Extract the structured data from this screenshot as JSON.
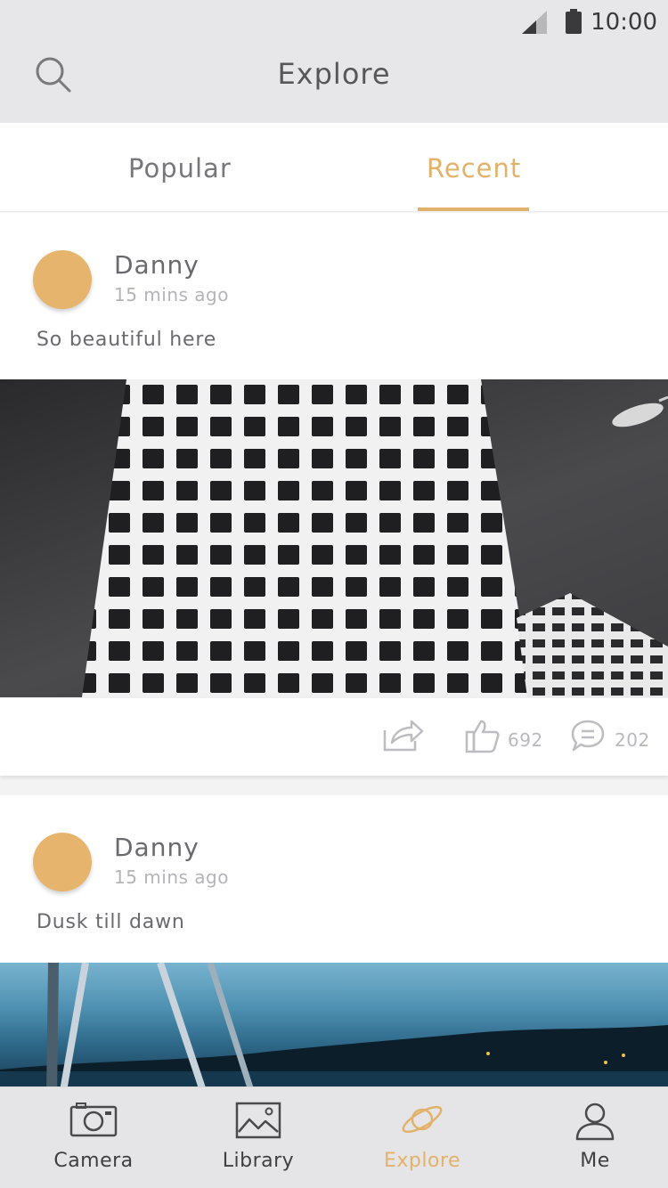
{
  "status": {
    "time": "10:00",
    "icons": [
      "signal-icon",
      "battery-icon"
    ]
  },
  "header": {
    "title": "Explore",
    "search_icon": "search-icon"
  },
  "tabs": [
    {
      "label": "Popular",
      "active": false
    },
    {
      "label": "Recent",
      "active": true
    }
  ],
  "posts": [
    {
      "author": "Danny",
      "time": "15 mins ago",
      "caption": "So beautiful here",
      "likes": "692",
      "comments": "202"
    },
    {
      "author": "Danny",
      "time": "15 mins ago",
      "caption": "Dusk till dawn"
    }
  ],
  "nav": [
    {
      "label": "Camera",
      "icon": "camera-icon",
      "active": false
    },
    {
      "label": "Library",
      "icon": "image-icon",
      "active": false
    },
    {
      "label": "Explore",
      "icon": "planet-icon",
      "active": true
    },
    {
      "label": "Me",
      "icon": "person-icon",
      "active": false
    }
  ],
  "colors": {
    "accent": "#e2b26a",
    "bar": "#e7e7e9",
    "avatar": "#e6b46c"
  }
}
